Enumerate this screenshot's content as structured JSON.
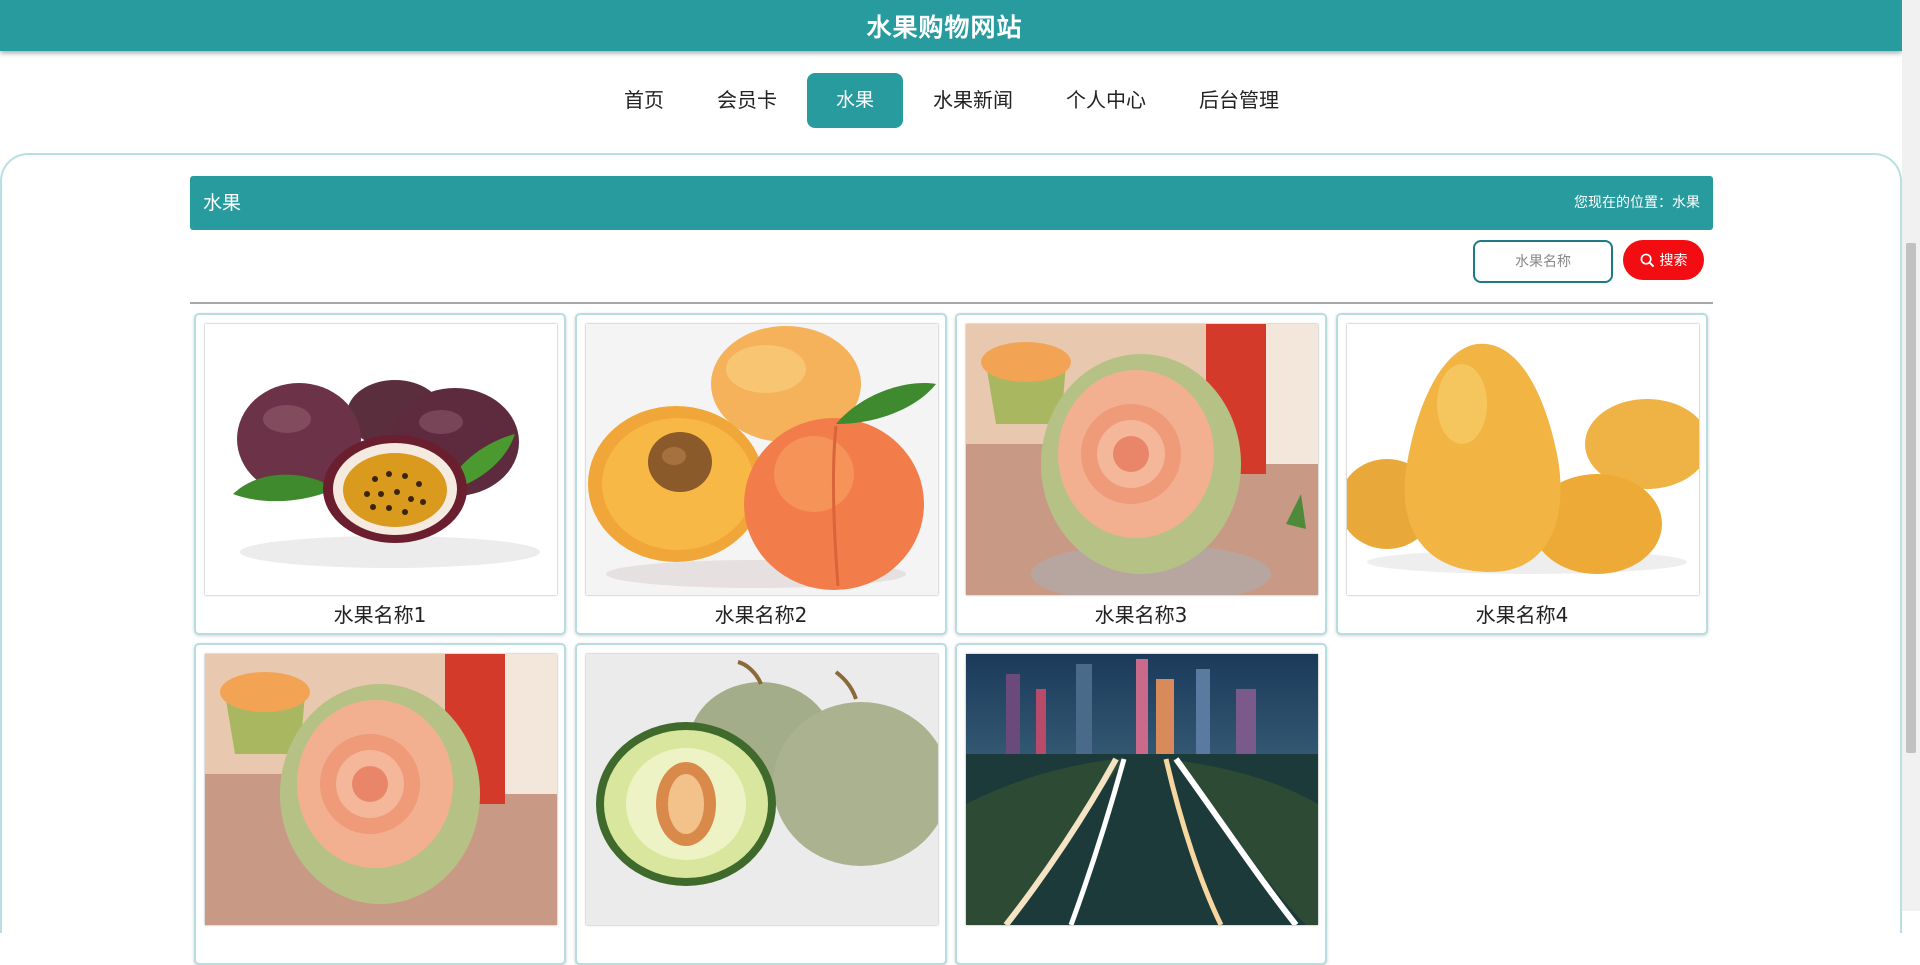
{
  "site": {
    "title": "水果购物网站"
  },
  "nav": {
    "items": [
      {
        "label": "首页"
      },
      {
        "label": "会员卡"
      },
      {
        "label": "水果"
      },
      {
        "label": "水果新闻"
      },
      {
        "label": "个人中心"
      },
      {
        "label": "后台管理"
      }
    ],
    "active": "水果"
  },
  "section": {
    "title": "水果",
    "breadcrumb": "您现在的位置：水果"
  },
  "search": {
    "placeholder": "水果名称",
    "value": "",
    "button_label": "搜索"
  },
  "products": [
    {
      "name": "水果名称1",
      "image": "passion-fruit"
    },
    {
      "name": "水果名称2",
      "image": "apricot"
    },
    {
      "name": "水果名称3",
      "image": "carved-watermelon"
    },
    {
      "name": "水果名称4",
      "image": "mango"
    },
    {
      "name": "",
      "image": "carved-watermelon"
    },
    {
      "name": "",
      "image": "cantaloupe"
    },
    {
      "name": "",
      "image": "city-night-road"
    }
  ],
  "colors": {
    "primary": "#279b9e",
    "search_button": "#f10d12",
    "card_border": "#b6dde0"
  }
}
